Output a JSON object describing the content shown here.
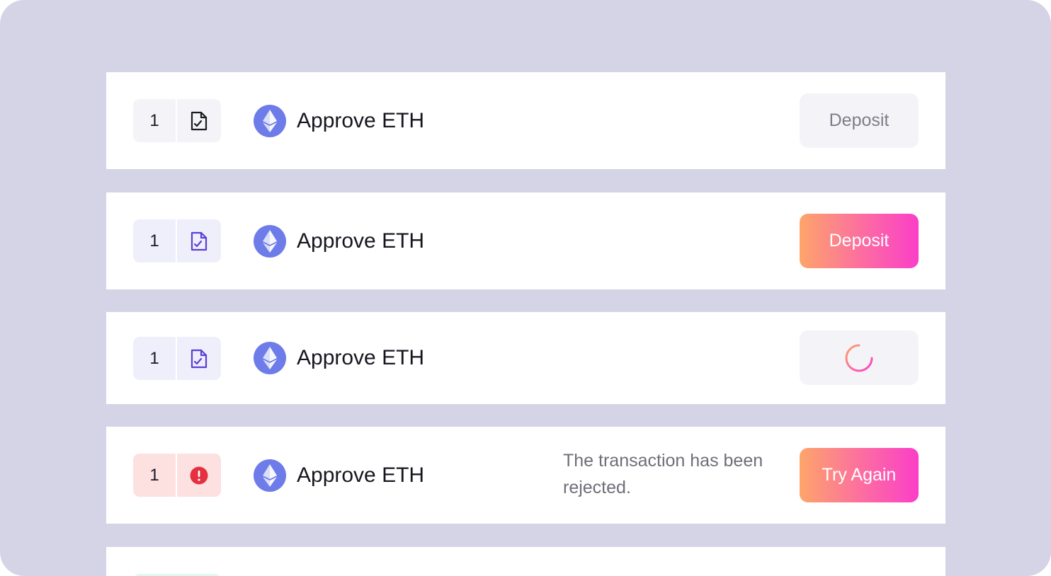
{
  "rows": [
    {
      "step_number": "1",
      "state": "disabled",
      "icon": "file-check-icon",
      "title": "Approve ETH",
      "button_label": "Deposit"
    },
    {
      "step_number": "1",
      "state": "active",
      "icon": "file-check-icon",
      "title": "Approve ETH",
      "button_label": "Deposit"
    },
    {
      "step_number": "1",
      "state": "loading",
      "icon": "file-check-icon",
      "title": "Approve ETH",
      "button_label": ""
    },
    {
      "step_number": "1",
      "state": "error",
      "icon": "error-icon",
      "title": "Approve ETH",
      "message": "The transaction has been rejected.",
      "button_label": "Try Again"
    }
  ],
  "colors": {
    "background": "#d5d4e6",
    "card": "#ffffff",
    "accent_purple": "#5b3fd6",
    "error_red": "#e5303f",
    "eth_blue": "#6d7ce8",
    "gradient_start": "#fda56a",
    "gradient_end": "#fb3fc8"
  }
}
